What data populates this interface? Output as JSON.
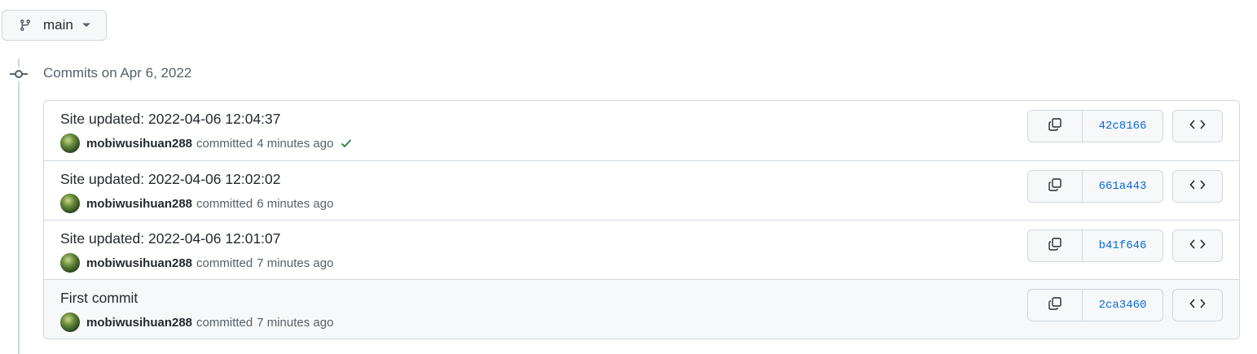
{
  "branch": {
    "name": "main"
  },
  "group": {
    "heading": "Commits on Apr 6, 2022"
  },
  "commits": [
    {
      "title": "Site updated: 2022-04-06 12:04:37",
      "author": "mobiwusihuan288",
      "committed": "committed",
      "time": "4 minutes ago",
      "sha": "42c8166",
      "status": "success"
    },
    {
      "title": "Site updated: 2022-04-06 12:02:02",
      "author": "mobiwusihuan288",
      "committed": "committed",
      "time": "6 minutes ago",
      "sha": "661a443",
      "status": ""
    },
    {
      "title": "Site updated: 2022-04-06 12:01:07",
      "author": "mobiwusihuan288",
      "committed": "committed",
      "time": "7 minutes ago",
      "sha": "b41f646",
      "status": ""
    },
    {
      "title": "First commit",
      "author": "mobiwusihuan288",
      "committed": "committed",
      "time": "7 minutes ago",
      "sha": "2ca3460",
      "status": ""
    }
  ],
  "colors": {
    "link": "#0969da",
    "success": "#1a7f37",
    "border": "#d0d7de",
    "muted": "#57606a"
  },
  "icons": {
    "branch": "git-branch-icon",
    "caret": "caret-down-icon",
    "commit": "git-commit-icon",
    "copy": "copy-icon",
    "code": "code-icon",
    "check": "check-icon"
  }
}
